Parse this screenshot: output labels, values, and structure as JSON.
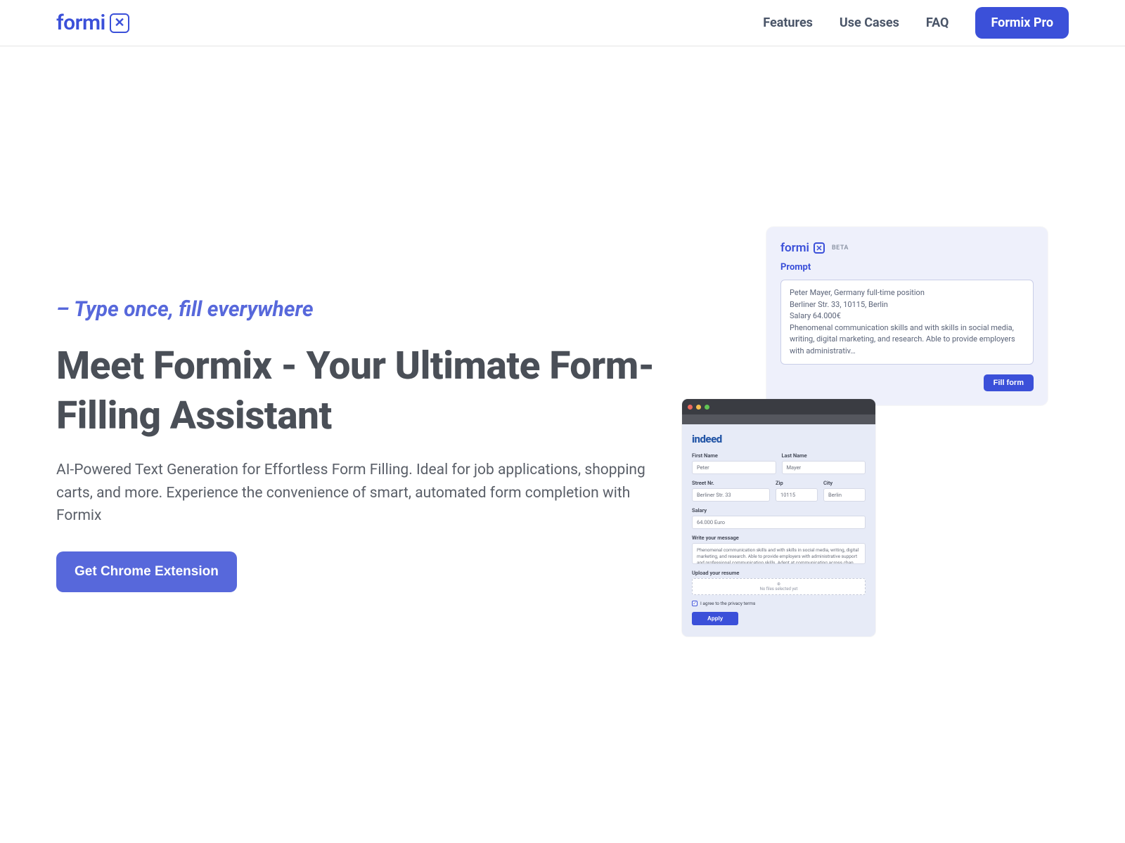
{
  "brand": {
    "name": "formi",
    "icon_glyph": "✕"
  },
  "nav": {
    "features": "Features",
    "use_cases": "Use Cases",
    "faq": "FAQ",
    "pro": "Formix Pro"
  },
  "hero": {
    "tagline": "– Type once, fill everywhere",
    "title": "Meet Formix - Your Ultimate Form-Filling Assistant",
    "subtitle": "AI-Powered Text Generation for Effortless Form Filling. Ideal for job applications, shopping carts, and more. Experience the convenience of smart, automated form completion with Formix",
    "cta": "Get Chrome Extension"
  },
  "prompt_card": {
    "logo_text": "formi",
    "beta": "BETA",
    "label": "Prompt",
    "lines": [
      "Peter Mayer, Germany full-time position",
      "Berliner Str. 33, 10115, Berlin",
      "Salary 64.000€",
      "Phenomenal communication skills and with skills in social media, writing, digital marketing, and research. Able to provide employers with administrativ…"
    ],
    "button": "Fill form"
  },
  "form_card": {
    "brand": "indeed",
    "first_name": {
      "label": "First Name",
      "value": "Peter"
    },
    "last_name": {
      "label": "Last Name",
      "value": "Mayer"
    },
    "street": {
      "label": "Street Nr.",
      "value": "Berliner Str. 33"
    },
    "zip": {
      "label": "Zip",
      "value": "10115"
    },
    "city": {
      "label": "City",
      "value": "Berlin"
    },
    "salary": {
      "label": "Salary",
      "value": "64.000 Euro"
    },
    "message": {
      "label": "Write your message",
      "value": "Phenomenal communication skills and with skills in social media, writing, digital marketing, and research. Able to provide employers with administrative support and professional communication skills. Adept at communicating across chan…"
    },
    "upload": {
      "label": "Upload your resume",
      "hint_icon": "⊕",
      "hint": "No files selected yet"
    },
    "privacy": "I agree to the privacy terms",
    "apply": "Apply"
  }
}
